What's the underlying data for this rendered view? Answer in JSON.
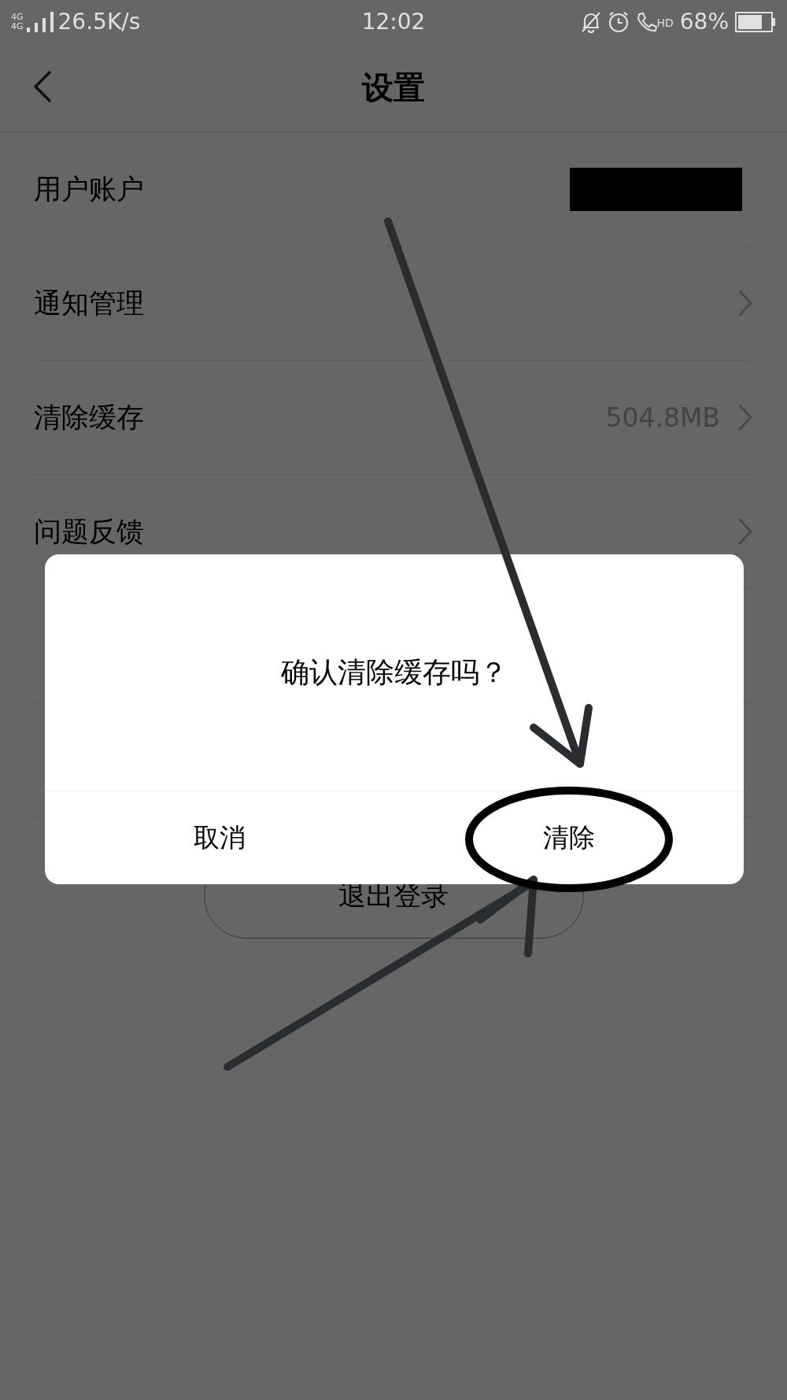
{
  "status_bar": {
    "network_labels": [
      "4G",
      "4G"
    ],
    "speed": "26.5K/s",
    "time": "12:02",
    "call_label": "HD",
    "battery": "68%"
  },
  "header": {
    "title": "设置"
  },
  "rows": [
    {
      "kind": "account",
      "label": "用户账户"
    },
    {
      "kind": "link",
      "label": "通知管理"
    },
    {
      "kind": "value",
      "label": "清除缓存",
      "value": "504.8MB"
    },
    {
      "kind": "link",
      "label": "问题反馈"
    },
    {
      "kind": "covered"
    },
    {
      "kind": "covered"
    }
  ],
  "logout_button": "退出登录",
  "dialog": {
    "message": "确认清除缓存吗？",
    "buttons": [
      {
        "label": "取消",
        "circled": false
      },
      {
        "label": "清除",
        "circled": true
      }
    ]
  }
}
